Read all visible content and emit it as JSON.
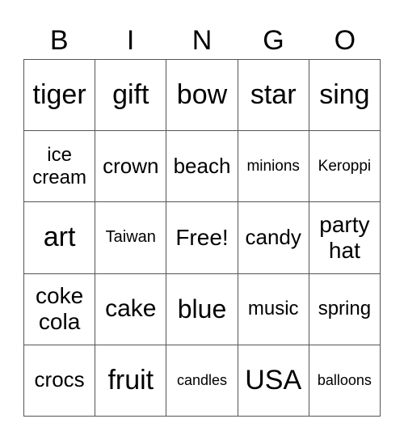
{
  "header": {
    "letters": [
      "B",
      "I",
      "N",
      "G",
      "O"
    ]
  },
  "grid": {
    "rows": [
      [
        "tiger",
        "gift",
        "bow",
        "star",
        "sing"
      ],
      [
        "ice cream",
        "crown",
        "beach",
        "minions",
        "Keroppi"
      ],
      [
        "art",
        "Taiwan",
        "Free!",
        "candy",
        "party hat"
      ],
      [
        "coke cola",
        "cake",
        "blue",
        "music",
        "spring"
      ],
      [
        "crocs",
        "fruit",
        "candles",
        "USA",
        "balloons"
      ]
    ]
  }
}
